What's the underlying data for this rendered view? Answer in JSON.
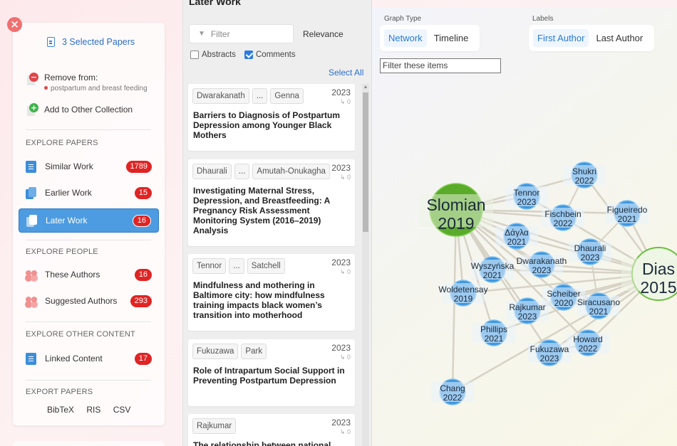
{
  "sidebar": {
    "selected_papers": "3 Selected Papers",
    "remove_from": "Remove from:",
    "collection_name": "postpartum and breast feeding",
    "add_to_other": "Add to Other Collection",
    "explore_papers_title": "EXPLORE PAPERS",
    "similar_work": "Similar Work",
    "similar_work_count": "1789",
    "earlier_work": "Earlier Work",
    "earlier_work_count": "15",
    "later_work": "Later Work",
    "later_work_count": "16",
    "explore_people_title": "EXPLORE PEOPLE",
    "these_authors": "These Authors",
    "these_authors_count": "16",
    "suggested_authors": "Suggested Authors",
    "suggested_authors_count": "293",
    "explore_other_title": "EXPLORE OTHER CONTENT",
    "linked_content": "Linked Content",
    "linked_content_count": "17",
    "export_title": "EXPORT PAPERS",
    "export_bibtex": "BibTeX",
    "export_ris": "RIS",
    "export_csv": "CSV"
  },
  "list": {
    "title": "Later Work",
    "filter_placeholder": "Filter",
    "sort": "Relevance",
    "abstracts_label": "Abstracts",
    "abstracts_checked": false,
    "comments_label": "Comments",
    "comments_checked": true,
    "select_all": "Select All",
    "papers": [
      {
        "authors": [
          "Dwarakanath",
          "...",
          "Genna"
        ],
        "year": "2023",
        "cites": "0",
        "title": "Barriers to Diagnosis of Postpartum Depression among Younger Black Mothers"
      },
      {
        "authors": [
          "Dhaurali",
          "...",
          "Amutah-Onukagha"
        ],
        "year": "2023",
        "cites": "0",
        "title": "Investigating Maternal Stress, Depression, and Breastfeeding: A Pregnancy Risk Assessment Monitoring System (2016–2019) Analysis"
      },
      {
        "authors": [
          "Tennor",
          "...",
          "Satchell"
        ],
        "year": "2023",
        "cites": "0",
        "title": "Mindfulness and mothering in Baltimore city: how mindfulness training impacts black women’s transition into motherhood"
      },
      {
        "authors": [
          "Fukuzawa",
          "Park"
        ],
        "year": "2023",
        "cites": "0",
        "title": "Role of Intrapartum Social Support in Preventing Postpartum Depression"
      },
      {
        "authors": [
          "Rajkumar"
        ],
        "year": "2023",
        "cites": "0",
        "title": "The relationship between national"
      }
    ]
  },
  "graph": {
    "graph_type_label": "Graph Type",
    "network": "Network",
    "timeline": "Timeline",
    "labels_label": "Labels",
    "first_author": "First Author",
    "last_author": "Last Author",
    "filter_placeholder": "Filter these items",
    "colors": {
      "origin": "#5aab2a",
      "node": "#3f97df",
      "edge": "#d6d2c6"
    },
    "big_nodes": [
      {
        "name": "Slomian",
        "year": "2019",
        "style": "origin"
      },
      {
        "name": "Dias",
        "year": "2015",
        "style": "outline"
      }
    ],
    "nodes": [
      {
        "name": "Shukri",
        "year": "2022"
      },
      {
        "name": "Tennor",
        "year": "2023"
      },
      {
        "name": "Figueiredo",
        "year": "2021"
      },
      {
        "name": "Fischbein",
        "year": "2022"
      },
      {
        "name": "Δάγλα",
        "year": "2021"
      },
      {
        "name": "Dhaurali",
        "year": "2023"
      },
      {
        "name": "Dwarakanath",
        "year": "2023"
      },
      {
        "name": "Wyszyńska",
        "year": "2021"
      },
      {
        "name": "Woldetensay",
        "year": "2019"
      },
      {
        "name": "Scheiber",
        "year": "2020"
      },
      {
        "name": "Siracusano",
        "year": "2021"
      },
      {
        "name": "Rajkumar",
        "year": "2023"
      },
      {
        "name": "Phillips",
        "year": "2021"
      },
      {
        "name": "Howard",
        "year": "2022"
      },
      {
        "name": "Fukuzawa",
        "year": "2023"
      },
      {
        "name": "Chang",
        "year": "2022"
      }
    ]
  }
}
